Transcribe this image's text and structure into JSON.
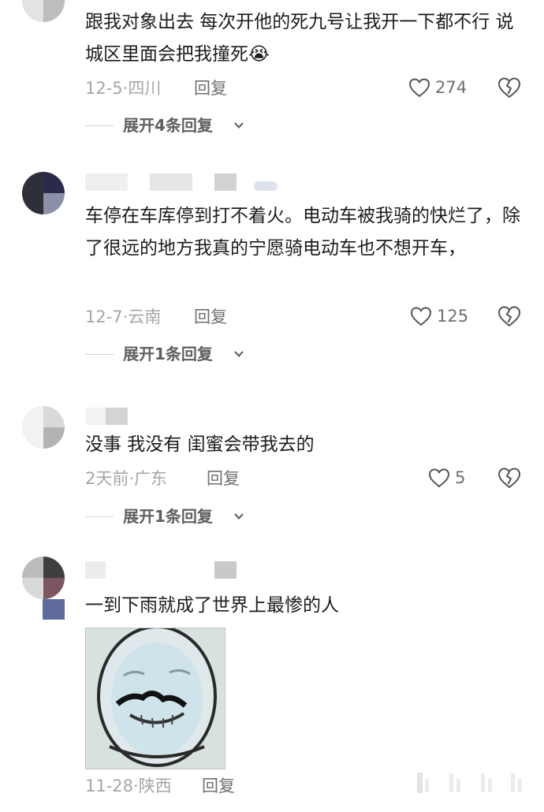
{
  "comments": [
    {
      "text": "跟我对象出去 每次开他的死九号让我开一下都不行 说城区里面会把我撞死😭",
      "date": "12-5",
      "location": "四川",
      "reply_label": "回复",
      "likes": "274",
      "expand_label": "展开4条回复"
    },
    {
      "text": "车停在车库停到打不着火。电动车被我骑的快烂了，除了很远的地方我真的宁愿骑电动车也不想开车，",
      "date": "12-7",
      "location": "云南",
      "reply_label": "回复",
      "likes": "125",
      "expand_label": "展开1条回复"
    },
    {
      "text": "没事 我没有 闺蜜会带我去的",
      "date": "2天前",
      "location": "广东",
      "reply_label": "回复",
      "likes": "5",
      "expand_label": "展开1条回复"
    },
    {
      "text": "一到下雨就成了世界上最惨的人",
      "date": "11-28",
      "location": "陕西",
      "reply_label": "回复"
    }
  ],
  "icons": {
    "like": "heart-outline-icon",
    "dislike": "broken-heart-icon",
    "expand": "chevron-down-icon"
  },
  "colors": {
    "text": "#1c1c1c",
    "meta": "#a6a6a6",
    "action": "#6f6f6f"
  }
}
